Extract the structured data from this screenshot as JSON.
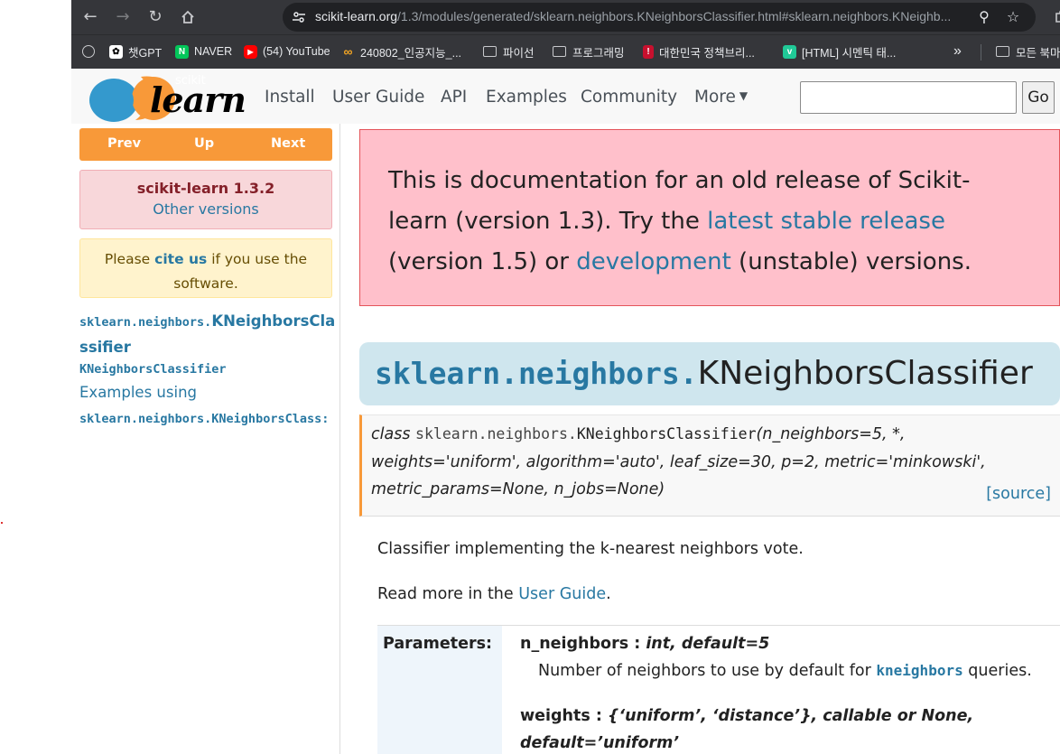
{
  "browser": {
    "url_host": "scikit-learn.org",
    "url_path": "/1.3/modules/generated/sklearn.neighbors.KNeighborsClassifier.html#sklearn.neighbors.KNeighb...",
    "bookmarks": [
      {
        "label": "챗GPT"
      },
      {
        "label": "NAVER"
      },
      {
        "label": "(54) YouTube"
      },
      {
        "label": "240802_인공지능_..."
      },
      {
        "label": "파이선"
      },
      {
        "label": "프로그래밍"
      },
      {
        "label": "대한민국 정책브리..."
      },
      {
        "label": "[HTML] 시멘틱 태..."
      },
      {
        "label": "모든 북마"
      }
    ],
    "more_bookmarks": "»"
  },
  "navbar": {
    "logo_small": "scikit",
    "logo_big": "learn",
    "links": [
      "Install",
      "User Guide",
      "API",
      "Examples",
      "Community",
      "More"
    ],
    "search_value": "",
    "go_label": "Go"
  },
  "sidebar": {
    "prev": "Prev",
    "up": "Up",
    "next": "Next",
    "version_title": "scikit-learn 1.3.2",
    "other_versions": "Other versions",
    "cite_pre": "Please",
    "cite_link": "cite us",
    "cite_post_line1": "if you use the",
    "cite_post_line2": "software.",
    "toc_module": "sklearn.neighbors.",
    "toc_class_part1": "KNeighborsCla",
    "toc_class_part2": "ssifier",
    "toc_sub": "KNeighborsClassifier",
    "examples_using": "Examples using",
    "examples_target": "sklearn.neighbors.KNeighborsClass:"
  },
  "main": {
    "warning_pre": "This is documentation for an old release of Scikit-learn (version 1.3). Try the",
    "warning_link1": "latest stable release",
    "warning_mid": "(version 1.5) or",
    "warning_link2": "development",
    "warning_post": "(unstable) versions.",
    "title_module": "sklearn.neighbors.",
    "title_class": "KNeighborsClassifier",
    "sig_kw": "class",
    "sig_module": "sklearn.neighbors.",
    "sig_class": "KNeighborsClassifier",
    "sig_line1_args": "(n_neighbors=5, *,",
    "sig_line2": "weights='uniform', algorithm='auto', leaf_size=30, p=2, metric='minkowski',",
    "sig_line3": "metric_params=None, n_jobs=None)",
    "source_link": "[source]",
    "desc": "Classifier implementing the k-nearest neighbors vote.",
    "readmore_pre": "Read more in the",
    "readmore_link": "User Guide",
    "readmore_post": ".",
    "params_label": "Parameters:",
    "p1_name": "n_neighbors : ",
    "p1_type": "int, default=5",
    "p1_desc_pre": "Number of neighbors to use by default for",
    "p1_desc_code": "kneighbors",
    "p1_desc_post": "queries.",
    "p2_name": "weights : ",
    "p2_type_line1": "{‘uniform’, ‘distance’}, callable or None,",
    "p2_type_line2": "default=’uniform’"
  }
}
